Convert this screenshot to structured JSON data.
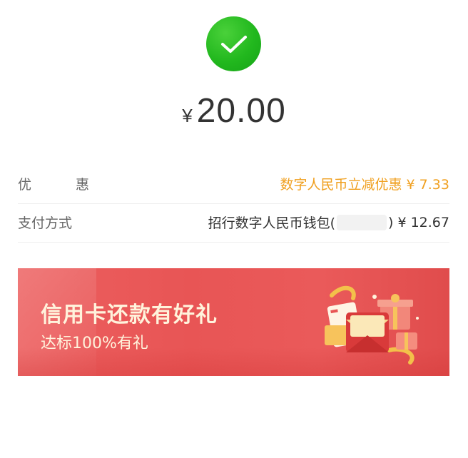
{
  "status": {
    "icon": "check-circle-icon",
    "color": "#22b81e"
  },
  "payment": {
    "currency_symbol": "¥",
    "amount": "20.00"
  },
  "details": {
    "discount": {
      "label": "优 惠",
      "value": "数字人民币立减优惠 ¥ 7.33",
      "color": "#f0a020"
    },
    "method": {
      "label": "支付方式",
      "wallet_prefix": "招行数字人民币钱包(",
      "wallet_suffix": ") ¥ 12.67"
    }
  },
  "banner": {
    "title": "信用卡还款有好礼",
    "subtitle": "达标100%有礼",
    "background": "#e85555",
    "art": "gift-box-envelope-icon"
  }
}
